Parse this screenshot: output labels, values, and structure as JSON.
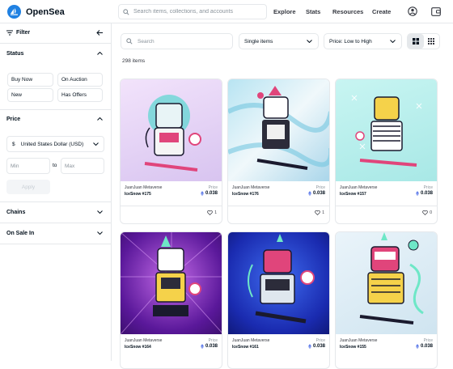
{
  "header": {
    "brand": "OpenSea",
    "search_placeholder": "Search items, collections, and accounts",
    "nav": [
      "Explore",
      "Stats",
      "Resources",
      "Create"
    ]
  },
  "sidebar": {
    "filter_label": "Filter",
    "status": {
      "title": "Status",
      "options": [
        "Buy Now",
        "On Auction",
        "New",
        "Has Offers"
      ]
    },
    "price": {
      "title": "Price",
      "currency": "United States Dollar (USD)",
      "min_placeholder": "Min",
      "to_label": "to",
      "max_placeholder": "Max",
      "apply_label": "Apply"
    },
    "chains": {
      "title": "Chains"
    },
    "on_sale_in": {
      "title": "On Sale In"
    }
  },
  "toolbar": {
    "search_placeholder": "Search",
    "type_select": "Single items",
    "sort_select": "Price: Low to High"
  },
  "results": {
    "count_text": "298 items"
  },
  "cards": [
    {
      "collection": "JuanJuan Metaverse",
      "name": "IceSnow #175",
      "price_label": "Price",
      "price": "0.038",
      "likes": "1",
      "bg": "#e9d6f5"
    },
    {
      "collection": "JuanJuan Metaverse",
      "name": "IceSnow #176",
      "price_label": "Price",
      "price": "0.038",
      "likes": "1",
      "bg": "#cdeaf5"
    },
    {
      "collection": "JuanJuan Metaverse",
      "name": "IceSnow #157",
      "price_label": "Price",
      "price": "0.038",
      "likes": "0",
      "bg": "#c9f3f1"
    },
    {
      "collection": "JuanJuan Metaverse",
      "name": "IceSnow #164",
      "price_label": "Price",
      "price": "0.038",
      "likes": "",
      "bg": "#6b1fa8"
    },
    {
      "collection": "JuanJuan Metaverse",
      "name": "IceSnow #161",
      "price_label": "Price",
      "price": "0.038",
      "likes": "",
      "bg": "#1c2fb8"
    },
    {
      "collection": "JuanJuan Metaverse",
      "name": "IceSnow #155",
      "price_label": "Price",
      "price": "0.038",
      "likes": "",
      "bg": "#dfeef6"
    }
  ],
  "colors": {
    "accent": "#2081e2",
    "eth": "#627eea"
  }
}
